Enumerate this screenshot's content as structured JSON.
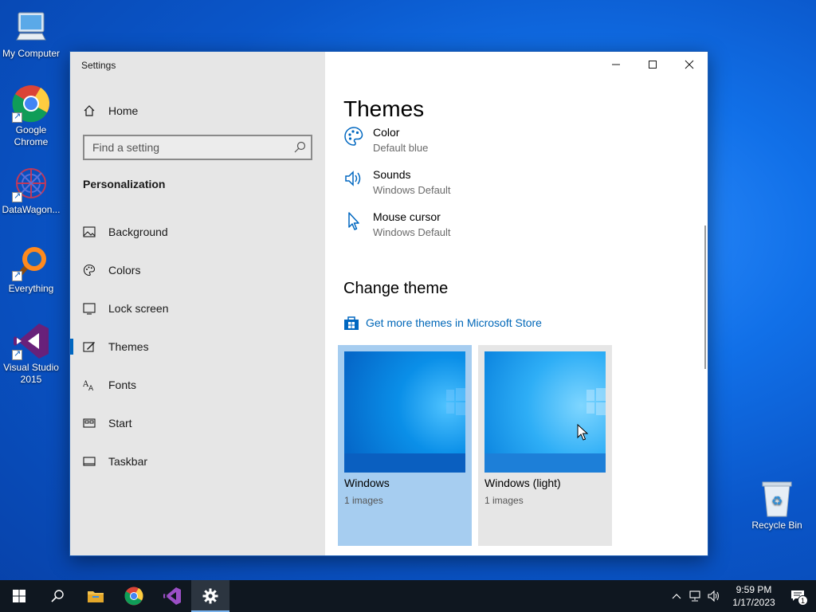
{
  "desktop": {
    "icons": [
      {
        "label": "My Computer"
      },
      {
        "label": "Google Chrome"
      },
      {
        "label": "DataWagon..."
      },
      {
        "label": "Everything"
      },
      {
        "label": "Visual Studio 2015"
      },
      {
        "label": "Recycle Bin"
      }
    ]
  },
  "window": {
    "title": "Settings",
    "controls": [
      "minimize-icon",
      "maximize-icon",
      "close-icon"
    ]
  },
  "nav": {
    "home_label": "Home",
    "search_placeholder": "Find a setting",
    "section_title": "Personalization",
    "items": [
      {
        "label": "Background",
        "icon": "picture-icon"
      },
      {
        "label": "Colors",
        "icon": "palette-icon"
      },
      {
        "label": "Lock screen",
        "icon": "lock-screen-icon"
      },
      {
        "label": "Themes",
        "icon": "themes-icon",
        "active": true
      },
      {
        "label": "Fonts",
        "icon": "fonts-icon"
      },
      {
        "label": "Start",
        "icon": "start-icon"
      },
      {
        "label": "Taskbar",
        "icon": "taskbar-icon"
      }
    ]
  },
  "content": {
    "title": "Themes",
    "options": [
      {
        "label": "Color",
        "value": "Default blue",
        "icon": "palette-icon"
      },
      {
        "label": "Sounds",
        "value": "Windows Default",
        "icon": "speaker-icon"
      },
      {
        "label": "Mouse cursor",
        "value": "Windows Default",
        "icon": "cursor-icon"
      }
    ],
    "change_theme_title": "Change theme",
    "store_link": "Get more themes in Microsoft Store",
    "themes": [
      {
        "name": "Windows",
        "count": "1 images",
        "selected": true
      },
      {
        "name": "Windows (light)",
        "count": "1 images",
        "selected": false
      }
    ]
  },
  "taskbar": {
    "items": [
      "windows-start-icon",
      "search-icon",
      "file-explorer-icon",
      "chrome-icon",
      "visual-studio-icon",
      "settings-gear-icon"
    ],
    "time": "9:59 PM",
    "date": "1/17/2023",
    "notification_count": "1"
  },
  "colors": {
    "accent": "#0067c0",
    "link": "#0067b8",
    "taskbar": "#0f1720",
    "nav_bg": "#e6e6e6",
    "selected_tile": "#a6cdf0"
  }
}
